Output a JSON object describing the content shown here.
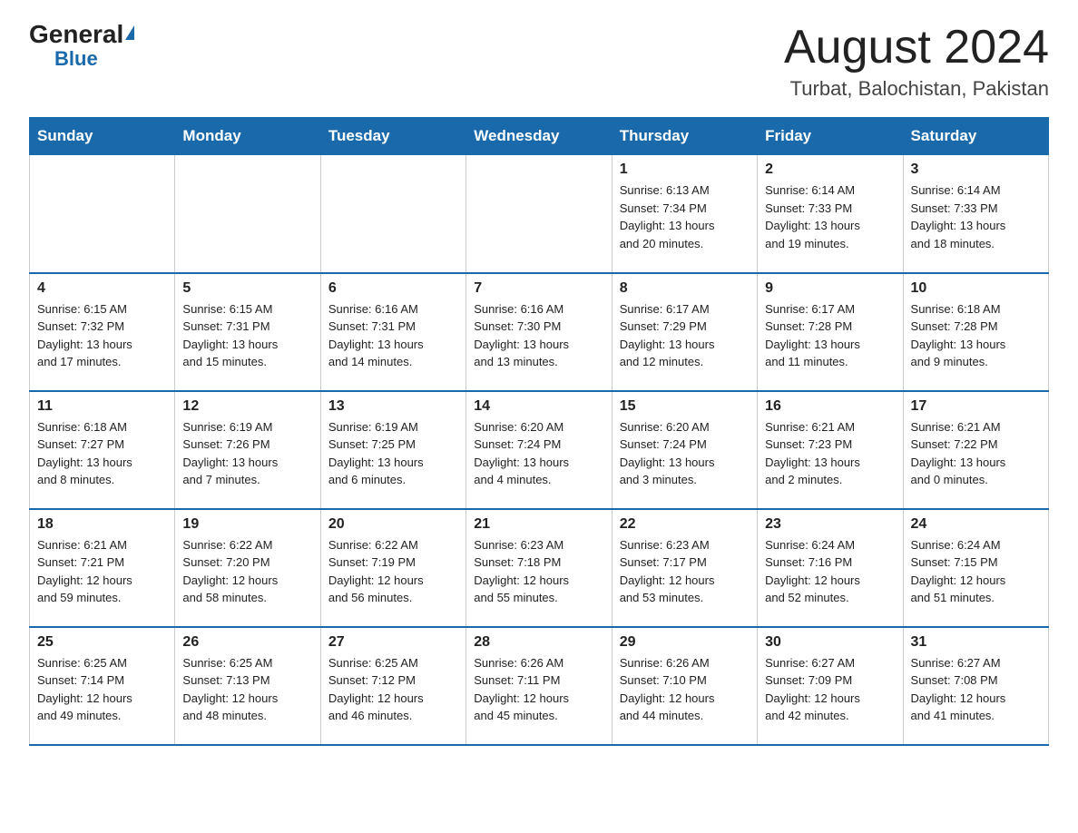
{
  "header": {
    "logo_general": "General",
    "logo_blue": "Blue",
    "month_title": "August 2024",
    "location": "Turbat, Balochistan, Pakistan"
  },
  "days_of_week": [
    "Sunday",
    "Monday",
    "Tuesday",
    "Wednesday",
    "Thursday",
    "Friday",
    "Saturday"
  ],
  "weeks": [
    [
      {
        "day": "",
        "info": ""
      },
      {
        "day": "",
        "info": ""
      },
      {
        "day": "",
        "info": ""
      },
      {
        "day": "",
        "info": ""
      },
      {
        "day": "1",
        "info": "Sunrise: 6:13 AM\nSunset: 7:34 PM\nDaylight: 13 hours\nand 20 minutes."
      },
      {
        "day": "2",
        "info": "Sunrise: 6:14 AM\nSunset: 7:33 PM\nDaylight: 13 hours\nand 19 minutes."
      },
      {
        "day": "3",
        "info": "Sunrise: 6:14 AM\nSunset: 7:33 PM\nDaylight: 13 hours\nand 18 minutes."
      }
    ],
    [
      {
        "day": "4",
        "info": "Sunrise: 6:15 AM\nSunset: 7:32 PM\nDaylight: 13 hours\nand 17 minutes."
      },
      {
        "day": "5",
        "info": "Sunrise: 6:15 AM\nSunset: 7:31 PM\nDaylight: 13 hours\nand 15 minutes."
      },
      {
        "day": "6",
        "info": "Sunrise: 6:16 AM\nSunset: 7:31 PM\nDaylight: 13 hours\nand 14 minutes."
      },
      {
        "day": "7",
        "info": "Sunrise: 6:16 AM\nSunset: 7:30 PM\nDaylight: 13 hours\nand 13 minutes."
      },
      {
        "day": "8",
        "info": "Sunrise: 6:17 AM\nSunset: 7:29 PM\nDaylight: 13 hours\nand 12 minutes."
      },
      {
        "day": "9",
        "info": "Sunrise: 6:17 AM\nSunset: 7:28 PM\nDaylight: 13 hours\nand 11 minutes."
      },
      {
        "day": "10",
        "info": "Sunrise: 6:18 AM\nSunset: 7:28 PM\nDaylight: 13 hours\nand 9 minutes."
      }
    ],
    [
      {
        "day": "11",
        "info": "Sunrise: 6:18 AM\nSunset: 7:27 PM\nDaylight: 13 hours\nand 8 minutes."
      },
      {
        "day": "12",
        "info": "Sunrise: 6:19 AM\nSunset: 7:26 PM\nDaylight: 13 hours\nand 7 minutes."
      },
      {
        "day": "13",
        "info": "Sunrise: 6:19 AM\nSunset: 7:25 PM\nDaylight: 13 hours\nand 6 minutes."
      },
      {
        "day": "14",
        "info": "Sunrise: 6:20 AM\nSunset: 7:24 PM\nDaylight: 13 hours\nand 4 minutes."
      },
      {
        "day": "15",
        "info": "Sunrise: 6:20 AM\nSunset: 7:24 PM\nDaylight: 13 hours\nand 3 minutes."
      },
      {
        "day": "16",
        "info": "Sunrise: 6:21 AM\nSunset: 7:23 PM\nDaylight: 13 hours\nand 2 minutes."
      },
      {
        "day": "17",
        "info": "Sunrise: 6:21 AM\nSunset: 7:22 PM\nDaylight: 13 hours\nand 0 minutes."
      }
    ],
    [
      {
        "day": "18",
        "info": "Sunrise: 6:21 AM\nSunset: 7:21 PM\nDaylight: 12 hours\nand 59 minutes."
      },
      {
        "day": "19",
        "info": "Sunrise: 6:22 AM\nSunset: 7:20 PM\nDaylight: 12 hours\nand 58 minutes."
      },
      {
        "day": "20",
        "info": "Sunrise: 6:22 AM\nSunset: 7:19 PM\nDaylight: 12 hours\nand 56 minutes."
      },
      {
        "day": "21",
        "info": "Sunrise: 6:23 AM\nSunset: 7:18 PM\nDaylight: 12 hours\nand 55 minutes."
      },
      {
        "day": "22",
        "info": "Sunrise: 6:23 AM\nSunset: 7:17 PM\nDaylight: 12 hours\nand 53 minutes."
      },
      {
        "day": "23",
        "info": "Sunrise: 6:24 AM\nSunset: 7:16 PM\nDaylight: 12 hours\nand 52 minutes."
      },
      {
        "day": "24",
        "info": "Sunrise: 6:24 AM\nSunset: 7:15 PM\nDaylight: 12 hours\nand 51 minutes."
      }
    ],
    [
      {
        "day": "25",
        "info": "Sunrise: 6:25 AM\nSunset: 7:14 PM\nDaylight: 12 hours\nand 49 minutes."
      },
      {
        "day": "26",
        "info": "Sunrise: 6:25 AM\nSunset: 7:13 PM\nDaylight: 12 hours\nand 48 minutes."
      },
      {
        "day": "27",
        "info": "Sunrise: 6:25 AM\nSunset: 7:12 PM\nDaylight: 12 hours\nand 46 minutes."
      },
      {
        "day": "28",
        "info": "Sunrise: 6:26 AM\nSunset: 7:11 PM\nDaylight: 12 hours\nand 45 minutes."
      },
      {
        "day": "29",
        "info": "Sunrise: 6:26 AM\nSunset: 7:10 PM\nDaylight: 12 hours\nand 44 minutes."
      },
      {
        "day": "30",
        "info": "Sunrise: 6:27 AM\nSunset: 7:09 PM\nDaylight: 12 hours\nand 42 minutes."
      },
      {
        "day": "31",
        "info": "Sunrise: 6:27 AM\nSunset: 7:08 PM\nDaylight: 12 hours\nand 41 minutes."
      }
    ]
  ]
}
